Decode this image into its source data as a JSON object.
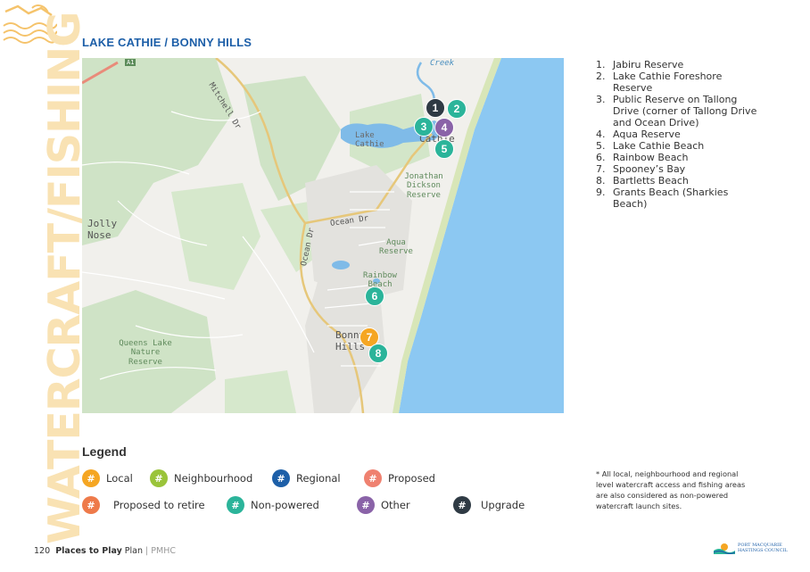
{
  "side_banner": "WATERCRAFT/FISHING",
  "title": "LAKE CATHIE / BONNY HILLS",
  "map": {
    "labels": {
      "creek": "Creek",
      "mitchell_dr": "Mitchell Dr",
      "lake_cathie_water": "Lake Cathie",
      "cathie": "Cathie",
      "jonathan_dickson": "Jonathan Dickson Reserve",
      "ocean_dr_1": "Ocean Dr",
      "ocean_dr_2": "Ocean Dr",
      "jolly_nose": "Jolly Nose",
      "aqua_reserve": "Aqua Reserve",
      "rainbow_beach": "Rainbow Beach",
      "bonny_hills": "Bonny Hills",
      "queens_lake": "Queens Lake Nature Reserve",
      "a1": "A1"
    },
    "pins": [
      {
        "id": "1",
        "type": "upgrade",
        "color": "#2f3a44"
      },
      {
        "id": "2",
        "type": "non-powered",
        "color": "#2bb49a"
      },
      {
        "id": "3",
        "type": "non-powered",
        "color": "#2bb49a"
      },
      {
        "id": "4",
        "type": "other",
        "color": "#8a63a8"
      },
      {
        "id": "5",
        "type": "non-powered",
        "color": "#2bb49a"
      },
      {
        "id": "6",
        "type": "non-powered",
        "color": "#2bb49a"
      },
      {
        "id": "7",
        "type": "local",
        "color": "#f5a623"
      },
      {
        "id": "8",
        "type": "non-powered",
        "color": "#2bb49a"
      }
    ]
  },
  "sites": [
    {
      "num": "1.",
      "name": "Jabiru Reserve"
    },
    {
      "num": "2.",
      "name": "Lake Cathie Foreshore Reserve"
    },
    {
      "num": "3.",
      "name": "Public Reserve on Tallong Drive (corner of Tallong Drive and Ocean Drive)"
    },
    {
      "num": "4.",
      "name": "Aqua Reserve"
    },
    {
      "num": "5.",
      "name": "Lake Cathie Beach"
    },
    {
      "num": "6.",
      "name": "Rainbow Beach"
    },
    {
      "num": "7.",
      "name": "Spooney’s Bay"
    },
    {
      "num": "8.",
      "name": "Bartletts Beach"
    },
    {
      "num": "9.",
      "name": "Grants Beach (Sharkies Beach)"
    }
  ],
  "legend": {
    "title": "Legend",
    "symbol": "#",
    "items": [
      {
        "label": "Local",
        "color": "#f5a623"
      },
      {
        "label": "Neighbourhood",
        "color": "#9ac43a"
      },
      {
        "label": "Regional",
        "color": "#1d5fa8"
      },
      {
        "label": "Proposed",
        "color": "#ef8170"
      },
      {
        "label": "Proposed to retire",
        "color": "#ee7a4a"
      },
      {
        "label": "Non-powered",
        "color": "#2bb49a"
      },
      {
        "label": "Other",
        "color": "#8a63a8"
      },
      {
        "label": "Upgrade",
        "color": "#2f3a44"
      }
    ]
  },
  "note": "* All local, neighbourhood and regional level watercraft access and fishing areas are also considered as non-powered watercraft launch sites.",
  "footer": {
    "page": "120",
    "bold": "Places to Play",
    "rest": "Plan",
    "sep": "|",
    "org": "PMHC"
  },
  "council_logo": "PORT MACQUARIE HASTINGS COUNCIL"
}
